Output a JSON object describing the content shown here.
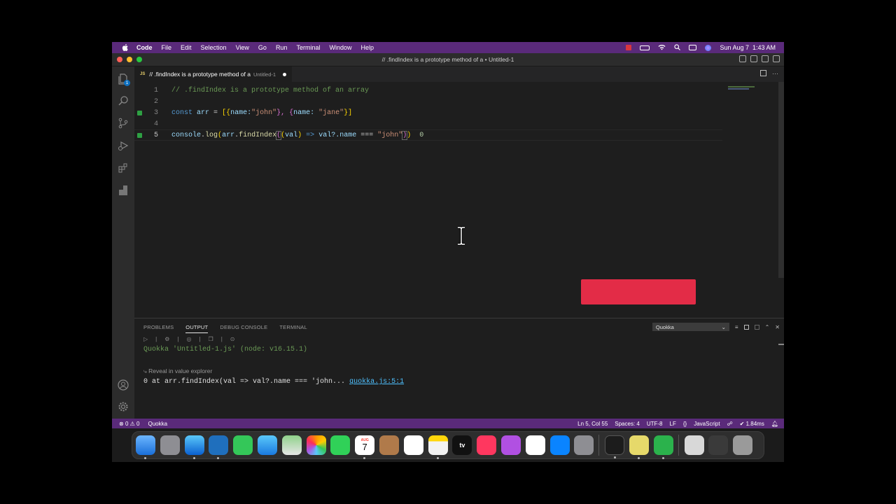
{
  "menubar": {
    "app": "Code",
    "items": [
      "File",
      "Edit",
      "Selection",
      "View",
      "Go",
      "Run",
      "Terminal",
      "Window",
      "Help"
    ],
    "datetime": "Sun Aug 7  1:43 AM"
  },
  "window": {
    "title": "// .findIndex is a prototype method of a • Untitled-1"
  },
  "activity": {
    "explorer_badge": "1"
  },
  "tab": {
    "icon_label": "JS",
    "title": "// .findIndex is a prototype method of a",
    "subtitle": "Untitled-1"
  },
  "editor": {
    "line_numbers": [
      "1",
      "2",
      "3",
      "4",
      "5"
    ],
    "line1_comment": "// .findIndex is a prototype method of an array",
    "line3": {
      "const": "const",
      "arr": "arr",
      "eq": " = ",
      "open": "[{",
      "key1": "name:",
      "val1": "\"john\"",
      "mid": "}, {",
      "key2": "name: ",
      "val2": "\"jane\"",
      "close": "}]"
    },
    "line5": {
      "console": "console",
      "dot1": ".",
      "log": "log",
      "p1": "(",
      "arr": "arr",
      "dot2": ".",
      "find": "findIndex",
      "p2": "(",
      "p3": "(",
      "val": "val",
      "p4": ")",
      "arrow": " => ",
      "expr": "val?.name",
      "eq3": " === ",
      "str": "\"john\"",
      "p5": ")",
      "p6": ")",
      "result": "0"
    }
  },
  "panel": {
    "tabs": [
      "PROBLEMS",
      "OUTPUT",
      "DEBUG CONSOLE",
      "TERMINAL"
    ],
    "active_tab": "OUTPUT",
    "output_channel": "Quokka",
    "output_line1": "Quokka 'Untitled-1.js' (node: v16.15.1)",
    "reveal": "Reveal in value explorer",
    "output_line2": "0 at arr.findIndex(val => val?.name === 'john... ",
    "output_link": "quokka.js:5:1"
  },
  "statusbar": {
    "errors": "0",
    "warnings": "0",
    "quokka": "Quokka",
    "position": "Ln 5, Col 55",
    "spaces": "Spaces: 4",
    "encoding": "UTF-8",
    "eol": "LF",
    "braces": "{}",
    "language": "JavaScript",
    "timing": "✔ 1.84ms"
  },
  "dock": {
    "calendar_month": "AUG",
    "calendar_day": "7",
    "tv_label": "tv"
  },
  "colors": {
    "menubar": "#5a2a7a",
    "statusbar": "#5a2a7a",
    "overlay_box": "#e32c47",
    "gutter_marker": "#2ea043"
  }
}
